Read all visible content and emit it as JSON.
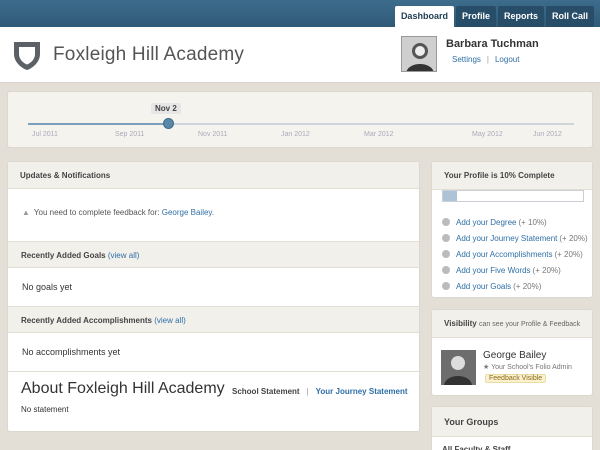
{
  "topnav": {
    "tabs": [
      {
        "label": "Dashboard",
        "active": true
      },
      {
        "label": "Profile",
        "active": false
      },
      {
        "label": "Reports",
        "active": false
      },
      {
        "label": "Roll Call",
        "active": false
      }
    ]
  },
  "header": {
    "school_name": "Foxleigh Hill Academy",
    "user_name": "Barbara Tuchman",
    "settings_link": "Settings",
    "logout_link": "Logout",
    "links_separator": "|"
  },
  "timeline": {
    "current_label": "Nov 2",
    "months": [
      "Jul 2011",
      "Sep 2011",
      "Nov 2011",
      "Jan 2012",
      "Mar 2012",
      "May 2012",
      "Jun 2012"
    ]
  },
  "updates": {
    "title": "Updates & Notifications",
    "notice_text": "You need to complete feedback for:",
    "notice_link": "George Bailey",
    "notice_end": "."
  },
  "goals": {
    "title": "Recently Added Goals",
    "view_all": "(view all)",
    "empty_text": "No goals yet"
  },
  "accomplishments": {
    "title": "Recently Added Accomplishments",
    "view_all": "(view all)",
    "empty_text": "No accomplishments yet"
  },
  "about": {
    "title": "About Foxleigh Hill Academy",
    "status": "No statement",
    "tab_school": "School Statement",
    "tab_separator": "|",
    "tab_journey": "Your Journey Statement"
  },
  "profile": {
    "title": "Your Profile is 10% Complete",
    "progress_fraction": 0.1,
    "items": [
      {
        "label": "Add your Degree",
        "bonus": "(+ 10%)"
      },
      {
        "label": "Add your Journey Statement",
        "bonus": "(+ 20%)"
      },
      {
        "label": "Add your Accomplishments",
        "bonus": "(+ 20%)"
      },
      {
        "label": "Add your Five Words",
        "bonus": "(+ 20%)"
      },
      {
        "label": "Add your Goals",
        "bonus": "(+ 20%)"
      }
    ]
  },
  "visibility": {
    "title": "Visibility",
    "subtitle": "can see your Profile & Feedback",
    "person_name": "George Bailey",
    "person_role": "★ Your School's Folio Admin",
    "badge": "Feedback Visible"
  },
  "groups": {
    "title": "Your Groups",
    "first_item_partial": "All Faculty & Staff"
  },
  "colors": {
    "topbar": "#2f5a78",
    "link": "#2f6fa6",
    "background": "#e3dfd6"
  }
}
